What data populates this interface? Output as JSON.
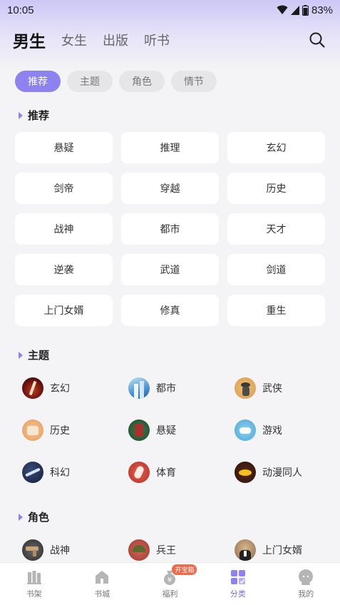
{
  "status": {
    "time": "10:05",
    "battery": "83%"
  },
  "top_tabs": [
    {
      "label": "男生",
      "active": true
    },
    {
      "label": "女生"
    },
    {
      "label": "出版"
    },
    {
      "label": "听书"
    }
  ],
  "chips": [
    {
      "label": "推荐",
      "active": true
    },
    {
      "label": "主题"
    },
    {
      "label": "角色"
    },
    {
      "label": "情节"
    }
  ],
  "sections": {
    "recommend": "推荐",
    "theme": "主题",
    "role": "角色"
  },
  "recommend_tags": [
    "悬疑",
    "推理",
    "玄幻",
    "剑帝",
    "穿越",
    "历史",
    "战神",
    "都市",
    "天才",
    "逆袭",
    "武道",
    "剑道",
    "上门女婿",
    "修真",
    "重生"
  ],
  "theme_items": [
    {
      "label": "玄幻",
      "icon": "fantasy-icon"
    },
    {
      "label": "都市",
      "icon": "city-icon"
    },
    {
      "label": "武侠",
      "icon": "martial-arts-icon"
    },
    {
      "label": "历史",
      "icon": "history-icon"
    },
    {
      "label": "悬疑",
      "icon": "mystery-icon"
    },
    {
      "label": "游戏",
      "icon": "game-icon"
    },
    {
      "label": "科幻",
      "icon": "scifi-icon"
    },
    {
      "label": "体育",
      "icon": "sports-icon"
    },
    {
      "label": "动漫同人",
      "icon": "anime-icon"
    }
  ],
  "role_items": [
    {
      "label": "战神",
      "icon": "war-god-icon"
    },
    {
      "label": "兵王",
      "icon": "soldier-icon"
    },
    {
      "label": "上门女婿",
      "icon": "son-in-law-icon"
    }
  ],
  "bottom_nav": [
    {
      "label": "书架",
      "icon": "bookshelf-icon"
    },
    {
      "label": "书城",
      "icon": "bookstore-icon"
    },
    {
      "label": "福利",
      "icon": "welfare-icon",
      "badge": "开宝箱"
    },
    {
      "label": "分类",
      "icon": "category-icon",
      "active": true
    },
    {
      "label": "我的",
      "icon": "profile-icon"
    }
  ],
  "colors": {
    "accent": "#8e82f1",
    "background": "#f4f4f6"
  }
}
